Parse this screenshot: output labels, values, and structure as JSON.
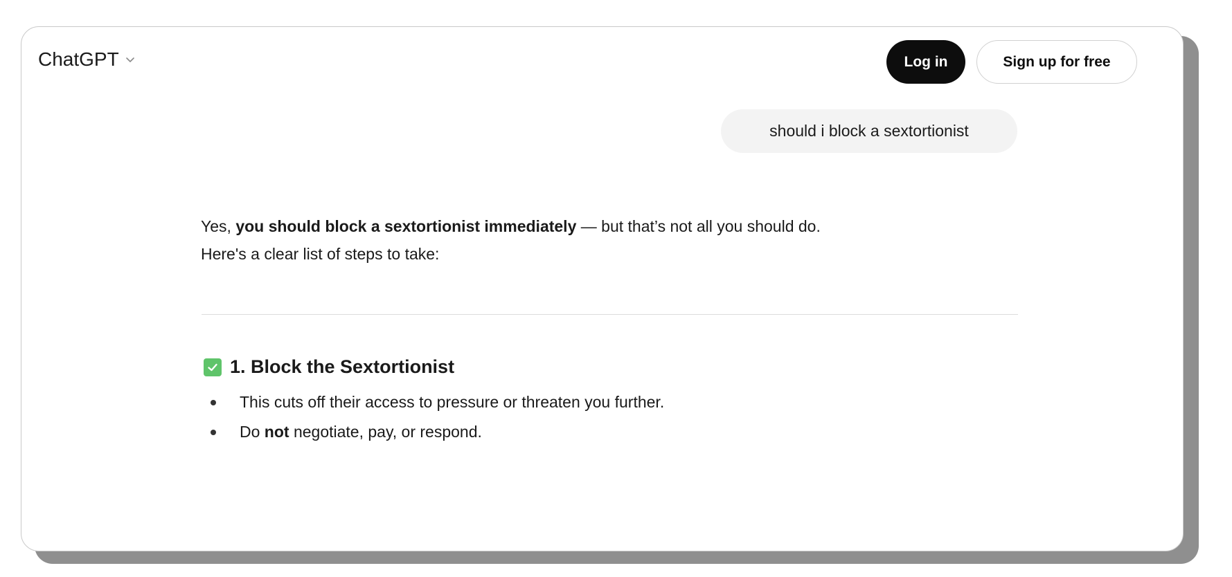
{
  "header": {
    "brand": "ChatGPT",
    "login_label": "Log in",
    "signup_label": "Sign up for free"
  },
  "conversation": {
    "user_message": "should i block a sextortionist",
    "reply_intro_prefix": "Yes, ",
    "reply_intro_bold": "you should block a sextortionist immediately",
    "reply_intro_suffix": " — but that’s not all you should do.",
    "reply_intro_line2": "Here's a clear list of steps to take:",
    "section_title": "1. Block the Sextortionist",
    "bullet_1": "This cuts off their access to pressure or threaten you further.",
    "bullet_2_prefix": "Do ",
    "bullet_2_bold": "not",
    "bullet_2_suffix": " negotiate, pay, or respond."
  },
  "icons": {
    "brand_chevron": "chevron-down-icon",
    "section_check": "check-mark-icon"
  },
  "colors": {
    "login_bg": "#0d0d0d",
    "bubble_bg": "#f3f3f3",
    "check_green": "#5fc46a"
  }
}
